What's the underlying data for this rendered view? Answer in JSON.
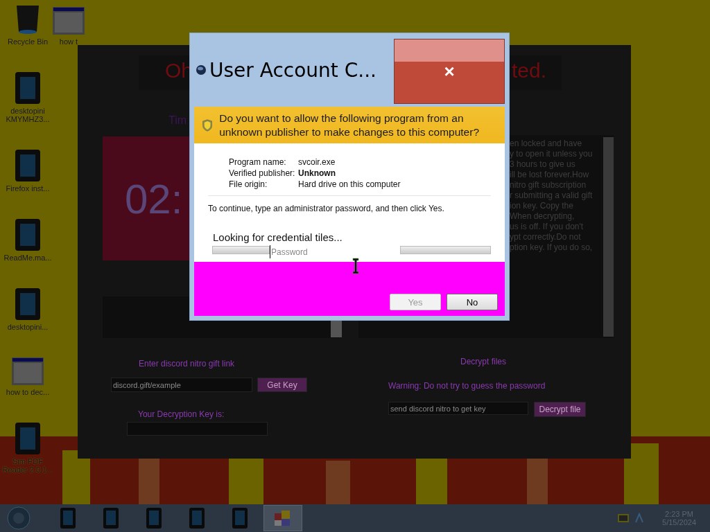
{
  "desktop_icons": [
    {
      "label": "Recycle Bin",
      "kind": "bin"
    },
    {
      "label": "desktopini KMYMHZ3...",
      "kind": "tablet"
    },
    {
      "label": "Firefox inst...",
      "kind": "tablet"
    },
    {
      "label": "ReadMe.ma...",
      "kind": "tablet"
    },
    {
      "label": "desktopini...",
      "kind": "tablet"
    },
    {
      "label": "how to dec...",
      "kind": "window"
    },
    {
      "label": "Sim PDF Reader 2.0.1...",
      "kind": "tablet"
    }
  ],
  "desktop_icon_top": {
    "label": "how t",
    "kind": "window"
  },
  "ransom_window": {
    "title_left": "Oh",
    "title_right": "ted.",
    "timer_label": "Tim",
    "timer": "02:",
    "message_lines": [
      "en locked and have",
      "y to open it unless you",
      "3 hours to give us",
      "ill be lost forever.How",
      "nitro gift subscription",
      "r submitting a valid gift",
      "ion key. Copy the",
      "When decrypting,",
      "us is off. If you don't",
      "ypt correctly.Do not",
      "ption key. If you do so,"
    ],
    "gift_label": "Enter discord nitro gift link",
    "gift_field": {
      "value": "discord.gift/example"
    },
    "get_key_button": "Get Key",
    "key_label": "Your Decryption Key is:",
    "decrypt_heading": "Decrypt files",
    "warning": "Warning: Do not try to guess the password",
    "key_field": {
      "value": "send discord nitro to get key"
    },
    "decrypt_button": "Decrypt file"
  },
  "uac_dialog": {
    "title": "User Account C...",
    "close": "×",
    "question": "Do you want to allow the following program from an unknown publisher to make changes to this computer?",
    "details": [
      {
        "label": "Program name:",
        "value": "svcoir.exe",
        "bold": false
      },
      {
        "label": "Verified publisher:",
        "value": "Unknown",
        "bold": true
      },
      {
        "label": "File origin:",
        "value": "Hard drive on this computer",
        "bold": false
      }
    ],
    "instruction": "To continue, type an administrator password, and then click Yes.",
    "status": "Looking for credential tiles...",
    "password": {
      "placeholder": "Password"
    },
    "buttons": [
      {
        "label": "Yes",
        "disabled": true
      },
      {
        "label": "No",
        "disabled": false
      }
    ]
  },
  "taskbar": {
    "items": [
      {
        "kind": "tablet",
        "selected": false
      },
      {
        "kind": "tablet",
        "selected": false
      },
      {
        "kind": "tablet",
        "selected": false
      },
      {
        "kind": "tablet",
        "selected": false
      },
      {
        "kind": "tablet",
        "selected": false
      },
      {
        "kind": "app",
        "selected": true
      }
    ],
    "time": "2:23 PM",
    "date": "5/15/2024"
  }
}
